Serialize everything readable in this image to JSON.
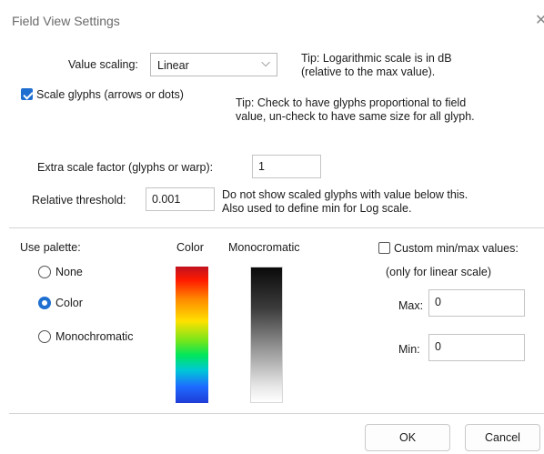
{
  "window": {
    "title": "Field View Settings"
  },
  "value_scaling": {
    "label": "Value scaling:",
    "selected": "Linear",
    "tip_line1": "Tip: Logarithmic scale is in dB",
    "tip_line2": "(relative to the max value)."
  },
  "scale_glyphs": {
    "label": "Scale glyphs (arrows or dots)",
    "checked": true,
    "tip_line1": "Tip: Check to have glyphs proportional to field",
    "tip_line2": "value, un-check to have same size for all glyph."
  },
  "extra_scale": {
    "label": "Extra scale factor (glyphs or warp):",
    "value": "1"
  },
  "relative_threshold": {
    "label": "Relative threshold:",
    "value": "0.001",
    "desc_line1": "Do not show scaled glyphs with value below this.",
    "desc_line2": "Also used to define min for Log scale."
  },
  "palette": {
    "label": "Use palette:",
    "options": [
      "None",
      "Color",
      "Monochromatic"
    ],
    "selected": "Color",
    "color_header": "Color",
    "mono_header": "Monocromatic"
  },
  "custom_minmax": {
    "label": "Custom min/max values:",
    "checked": false,
    "note": "(only for linear scale)",
    "max_label": "Max:",
    "max_value": "0",
    "min_label": "Min:",
    "min_value": "0"
  },
  "buttons": {
    "ok": "OK",
    "cancel": "Cancel"
  },
  "colors": {
    "accent": "#1f6fd1"
  }
}
